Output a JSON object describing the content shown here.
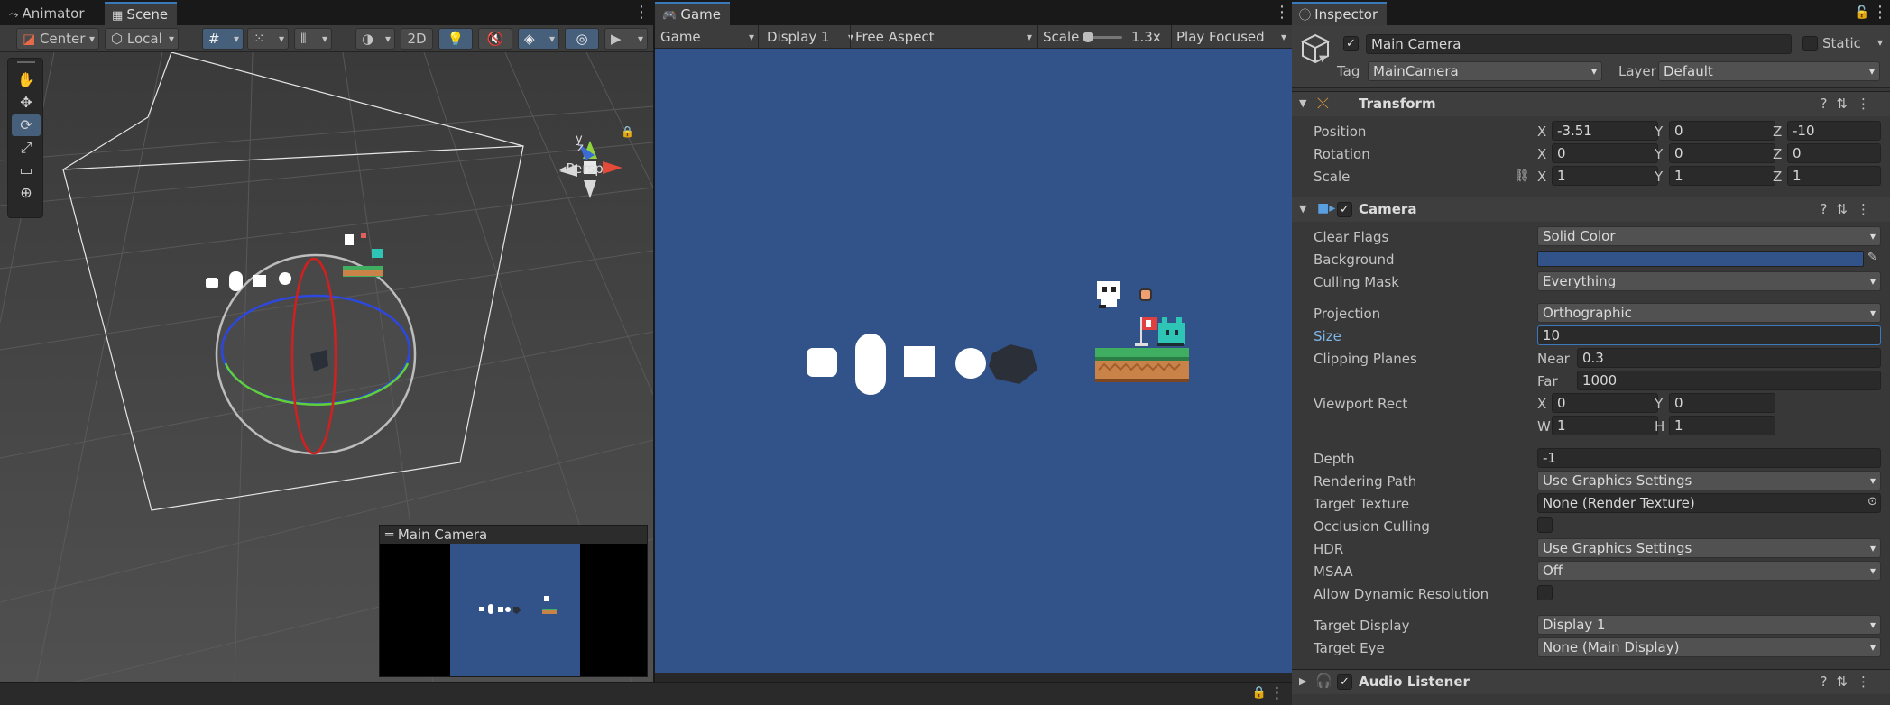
{
  "scene_panel": {
    "tabs": [
      {
        "label": "Animator"
      },
      {
        "label": "Scene"
      }
    ],
    "toolbar": {
      "pivot": "Center",
      "space": "Local",
      "mode_2d": "2D"
    },
    "gizmo": {
      "persp_label": "Persp",
      "axis_y": "y",
      "axis_z": "z"
    },
    "camera_preview": {
      "title": "Main Camera"
    }
  },
  "game_panel": {
    "tab": {
      "label": "Game"
    },
    "bar": {
      "view": "Game",
      "display": "Display 1",
      "aspect": "Free Aspect",
      "scale_label": "Scale",
      "scale_value": "1.3x",
      "play_mode": "Play Focused"
    },
    "background_color": "#32538a"
  },
  "inspector": {
    "tab": {
      "label": "Inspector"
    },
    "object": {
      "name": "Main Camera",
      "static_label": "Static",
      "tag_label": "Tag",
      "tag": "MainCamera",
      "layer_label": "Layer",
      "layer": "Default"
    },
    "transform": {
      "title": "Transform",
      "position": {
        "label": "Position",
        "x": "-3.51",
        "y": "0",
        "z": "-10"
      },
      "rotation": {
        "label": "Rotation",
        "x": "0",
        "y": "0",
        "z": "0"
      },
      "scale": {
        "label": "Scale",
        "x": "1",
        "y": "1",
        "z": "1"
      },
      "axis_x": "X",
      "axis_y": "Y",
      "axis_z": "Z"
    },
    "camera": {
      "title": "Camera",
      "clear_flags": {
        "label": "Clear Flags",
        "value": "Solid Color"
      },
      "background": {
        "label": "Background",
        "color": "#32538a"
      },
      "culling_mask": {
        "label": "Culling Mask",
        "value": "Everything"
      },
      "projection": {
        "label": "Projection",
        "value": "Orthographic"
      },
      "size": {
        "label": "Size",
        "value": "10"
      },
      "clipping": {
        "label": "Clipping Planes",
        "near_label": "Near",
        "near": "0.3",
        "far_label": "Far",
        "far": "1000"
      },
      "viewport": {
        "label": "Viewport Rect",
        "x_label": "X",
        "x": "0",
        "y_label": "Y",
        "y": "0",
        "w_label": "W",
        "w": "1",
        "h_label": "H",
        "h": "1"
      },
      "depth": {
        "label": "Depth",
        "value": "-1"
      },
      "rendering_path": {
        "label": "Rendering Path",
        "value": "Use Graphics Settings"
      },
      "target_texture": {
        "label": "Target Texture",
        "value": "None (Render Texture)"
      },
      "occlusion_culling": {
        "label": "Occlusion Culling"
      },
      "hdr": {
        "label": "HDR",
        "value": "Use Graphics Settings"
      },
      "msaa": {
        "label": "MSAA",
        "value": "Off"
      },
      "dynamic_resolution": {
        "label": "Allow Dynamic Resolution"
      },
      "target_display": {
        "label": "Target Display",
        "value": "Display 1"
      },
      "target_eye": {
        "label": "Target Eye",
        "value": "None (Main Display)"
      }
    },
    "audio_listener": {
      "title": "Audio Listener"
    }
  },
  "colors": {
    "accent": "#3a79bb",
    "selection": "#46607c",
    "game_bg": "#32538a"
  }
}
